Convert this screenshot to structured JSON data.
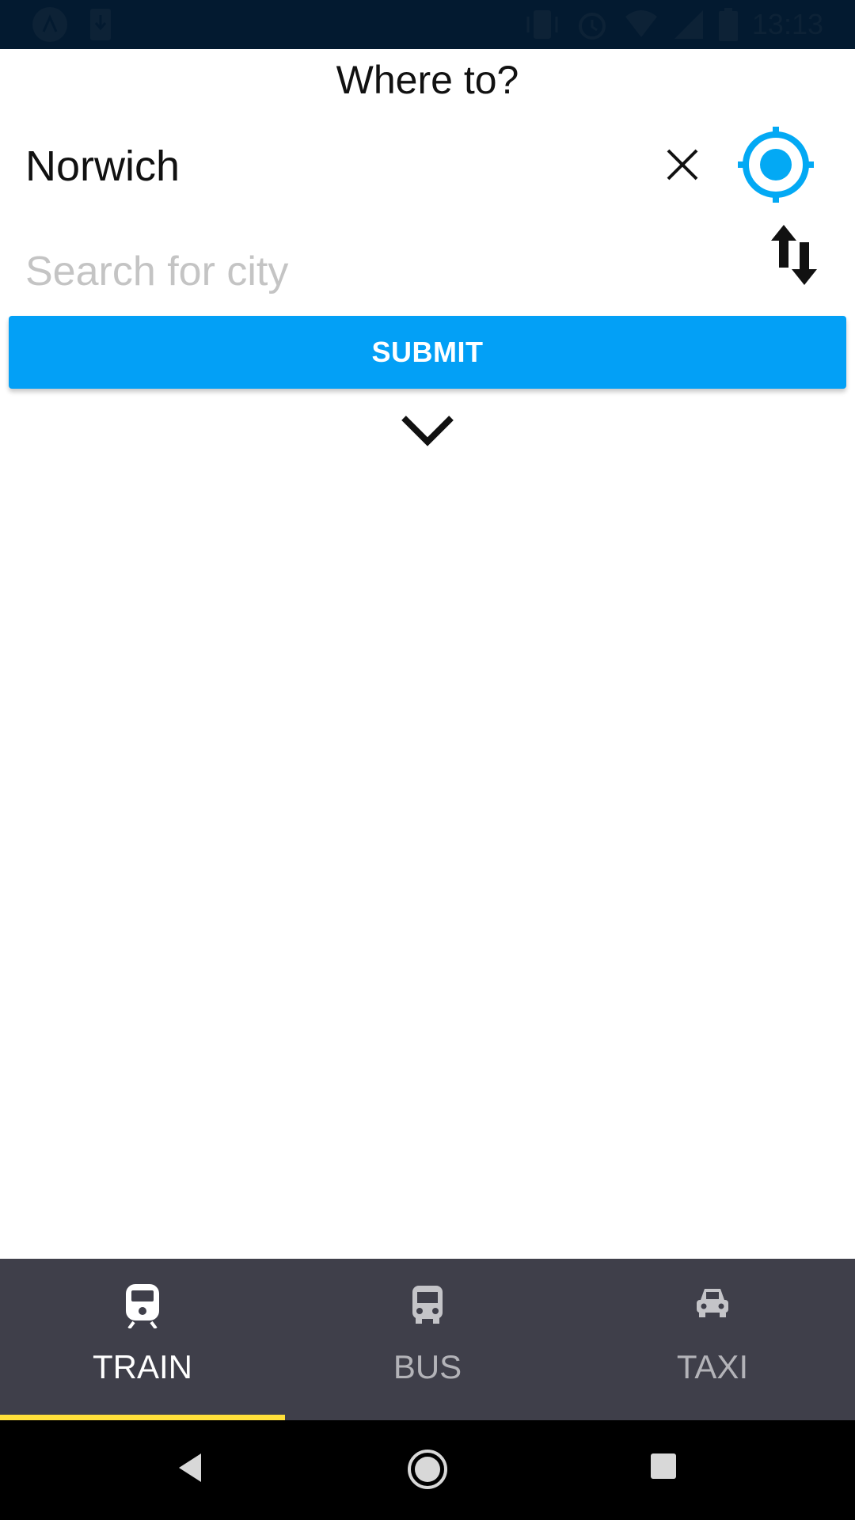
{
  "status_bar": {
    "time": "13:13",
    "left_icons": [
      "app-icon",
      "download-icon"
    ],
    "right_icons": [
      "vibrate-icon",
      "alarm-icon",
      "wifi-icon",
      "signal-icon",
      "battery-icon"
    ]
  },
  "header": {
    "title": "Where to?"
  },
  "from": {
    "value": "Norwich"
  },
  "to": {
    "placeholder": "Search for city",
    "value": ""
  },
  "actions": {
    "submit_label": "SUBMIT"
  },
  "tabs": [
    {
      "label": "TRAIN",
      "icon": "train-icon",
      "active": true
    },
    {
      "label": "BUS",
      "icon": "bus-icon",
      "active": false
    },
    {
      "label": "TAXI",
      "icon": "car-icon",
      "active": false
    }
  ],
  "colors": {
    "accent": "#03a0f6",
    "tab_bar": "#3f3f4a",
    "tab_indicator": "#ffe03a",
    "status_bar": "#031a30"
  }
}
